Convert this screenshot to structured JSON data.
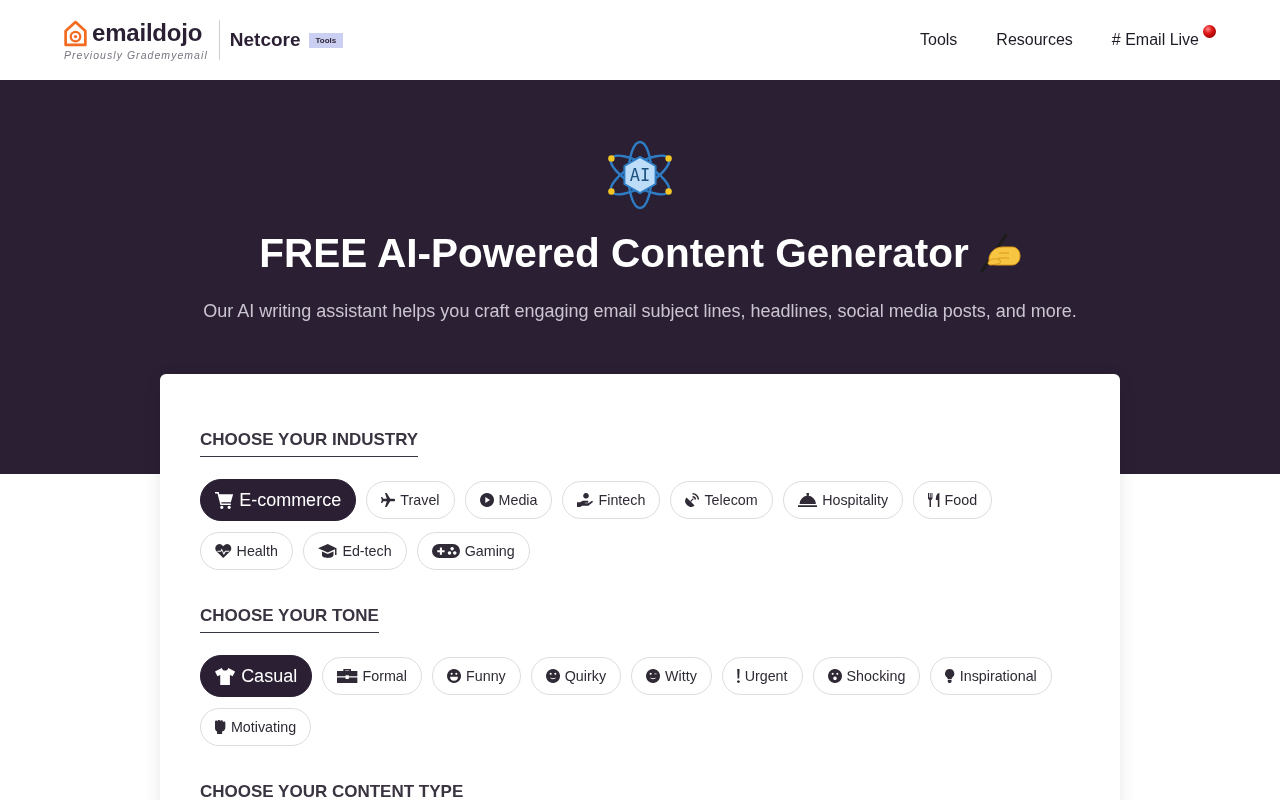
{
  "header": {
    "brand": {
      "name": "emaildojo",
      "tagline": "Previously Grademyemail"
    },
    "partner": {
      "name": "Netcore",
      "tag": "Tools"
    },
    "nav": [
      {
        "label": "Tools",
        "live": false
      },
      {
        "label": "Resources",
        "live": false
      },
      {
        "label": "# Email Live",
        "live": true
      }
    ]
  },
  "hero": {
    "icon_label": "AI",
    "title": "FREE AI-Powered Content Generator",
    "subtitle": "Our AI writing assistant helps you craft engaging email subject lines, headlines, social media posts, and more."
  },
  "form": {
    "sections": [
      {
        "heading": "CHOOSE YOUR INDUSTRY",
        "options": [
          {
            "label": "E-commerce",
            "selected": true
          },
          {
            "label": "Travel",
            "selected": false
          },
          {
            "label": "Media",
            "selected": false
          },
          {
            "label": "Fintech",
            "selected": false
          },
          {
            "label": "Telecom",
            "selected": false
          },
          {
            "label": "Hospitality",
            "selected": false
          },
          {
            "label": "Food",
            "selected": false
          },
          {
            "label": "Health",
            "selected": false
          },
          {
            "label": "Ed-tech",
            "selected": false
          },
          {
            "label": "Gaming",
            "selected": false
          }
        ]
      },
      {
        "heading": "CHOOSE YOUR TONE",
        "options": [
          {
            "label": "Casual",
            "selected": true
          },
          {
            "label": "Formal",
            "selected": false
          },
          {
            "label": "Funny",
            "selected": false
          },
          {
            "label": "Quirky",
            "selected": false
          },
          {
            "label": "Witty",
            "selected": false
          },
          {
            "label": "Urgent",
            "selected": false
          },
          {
            "label": "Shocking",
            "selected": false
          },
          {
            "label": "Inspirational",
            "selected": false
          },
          {
            "label": "Motivating",
            "selected": false
          }
        ]
      },
      {
        "heading": "CHOOSE YOUR CONTENT TYPE"
      }
    ]
  }
}
